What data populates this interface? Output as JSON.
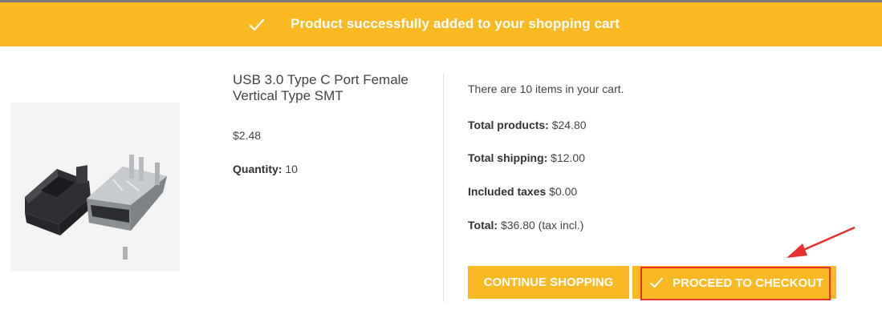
{
  "banner": {
    "message": "Product successfully added to your shopping cart",
    "icon": "check-icon",
    "background": "#fbb924"
  },
  "product": {
    "image_alt": "USB Type C female connector",
    "name": "USB 3.0 Type C Port Female Vertical Type SMT",
    "price": "$2.48",
    "quantity_label": "Quantity:",
    "quantity_value": "10"
  },
  "cart": {
    "items_text": "There are 10 items in your cart.",
    "total_products_label": "Total products:",
    "total_products_value": "$24.80",
    "total_shipping_label": "Total shipping:",
    "total_shipping_value": "$12.00",
    "included_taxes_label": "Included taxes",
    "included_taxes_value": "$0.00",
    "total_label": "Total:",
    "total_value": "$36.80 (tax incl.)"
  },
  "buttons": {
    "continue_label": "CONTINUE SHOPPING",
    "checkout_label": "PROCEED TO CHECKOUT",
    "checkout_icon": "check-icon"
  },
  "annotation": {
    "color": "#e8302e"
  }
}
